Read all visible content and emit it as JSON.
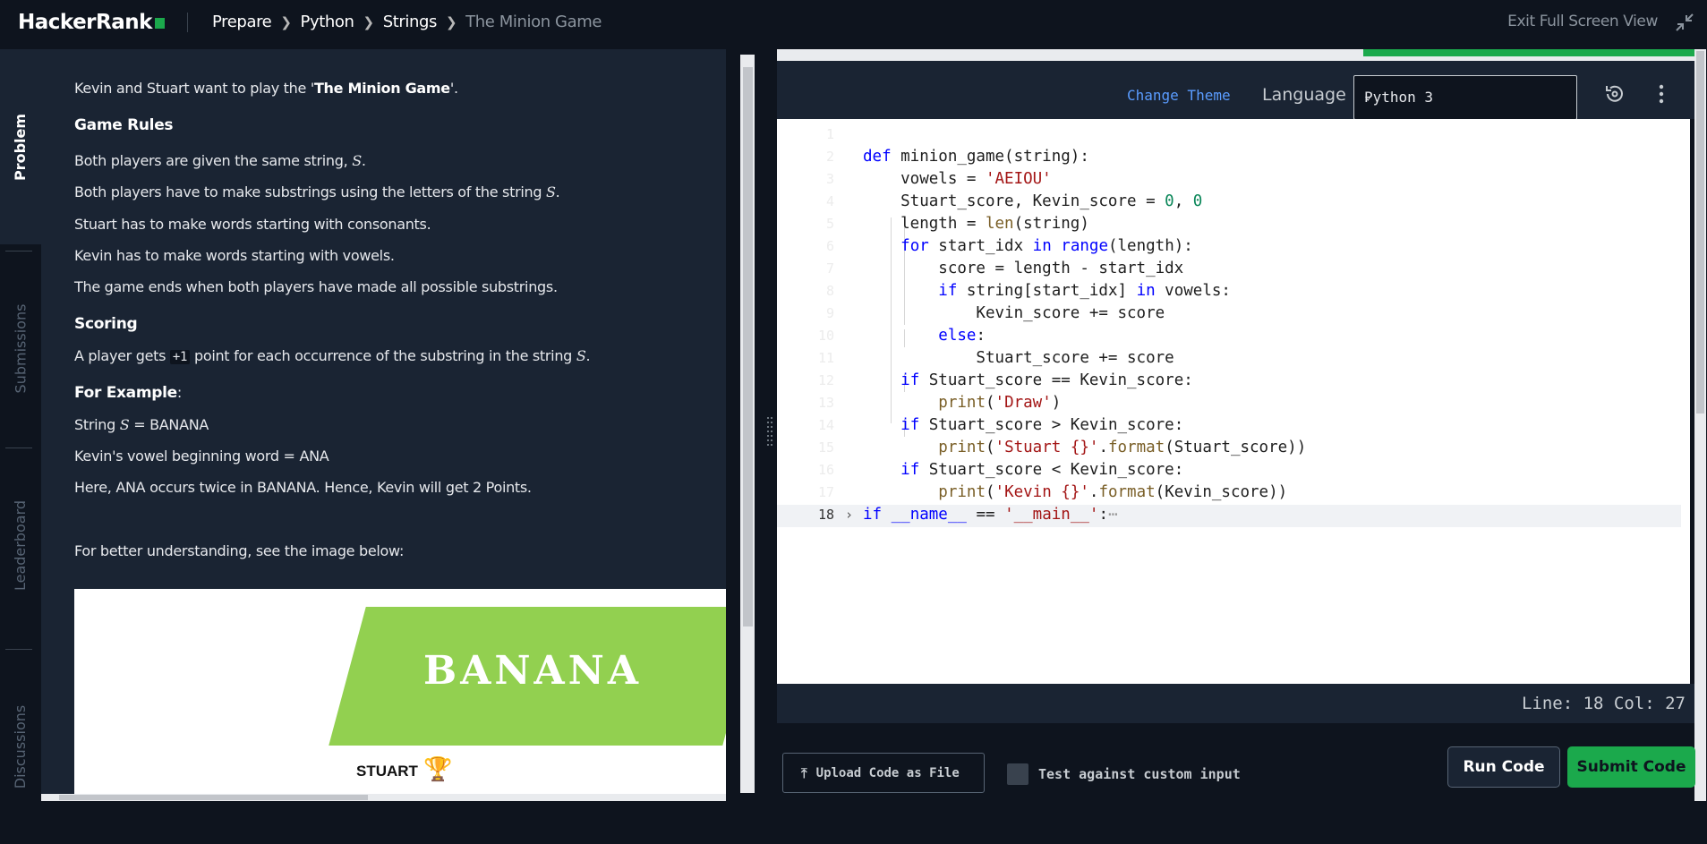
{
  "header": {
    "logo": "HackerRank",
    "breadcrumbs": [
      "Prepare",
      "Python",
      "Strings"
    ],
    "current": "The Minion Game",
    "exit_fullscreen": "Exit Full Screen View"
  },
  "sidenav": {
    "tabs": [
      "Problem",
      "Submissions",
      "Leaderboard",
      "Discussions"
    ],
    "active": "Problem"
  },
  "problem": {
    "intro_pre": "Kevin and Stuart want to play the '",
    "intro_bold": "The Minion Game",
    "intro_post": "'.",
    "rules_heading": "Game Rules",
    "rule1": "Both players are given the same string, ",
    "rule2": "Both players have to make substrings using the letters of the string ",
    "rule3": "Stuart has to make words starting with consonants.",
    "rule4": "Kevin has to make words starting with vowels.",
    "rule5": "The game ends when both players have made all possible substrings.",
    "scoring_heading": "Scoring",
    "scoring_pre": "A player gets ",
    "scoring_kbd": "+1",
    "scoring_post": " point for each occurrence of the substring in the string ",
    "example_heading": "For Example",
    "example_colon": ":",
    "ex1_pre": "String ",
    "ex1_post": " = BANANA",
    "ex2": "Kevin's vowel beginning word = ANA",
    "ex3": "Here, ANA occurs twice in BANANA. Hence, Kevin will get 2 Points.",
    "understanding": "For better understanding, see the image below:",
    "math_s": "S",
    "period": ".",
    "image_word": "BANANA",
    "image_label": "STUART"
  },
  "editor": {
    "change_theme": "Change Theme",
    "language_label": "Language",
    "language": "Python 3",
    "status": "Line: 18  Col: 27",
    "line_numbers": [
      "1",
      "2",
      "3",
      "4",
      "5",
      "6",
      "7",
      "8",
      "9",
      "10",
      "11",
      "12",
      "13",
      "14",
      "15",
      "16",
      "17",
      "18"
    ]
  },
  "actions": {
    "upload": "Upload Code as File",
    "custom_input": "Test against custom input",
    "run": "Run Code",
    "submit": "Submit Code"
  }
}
